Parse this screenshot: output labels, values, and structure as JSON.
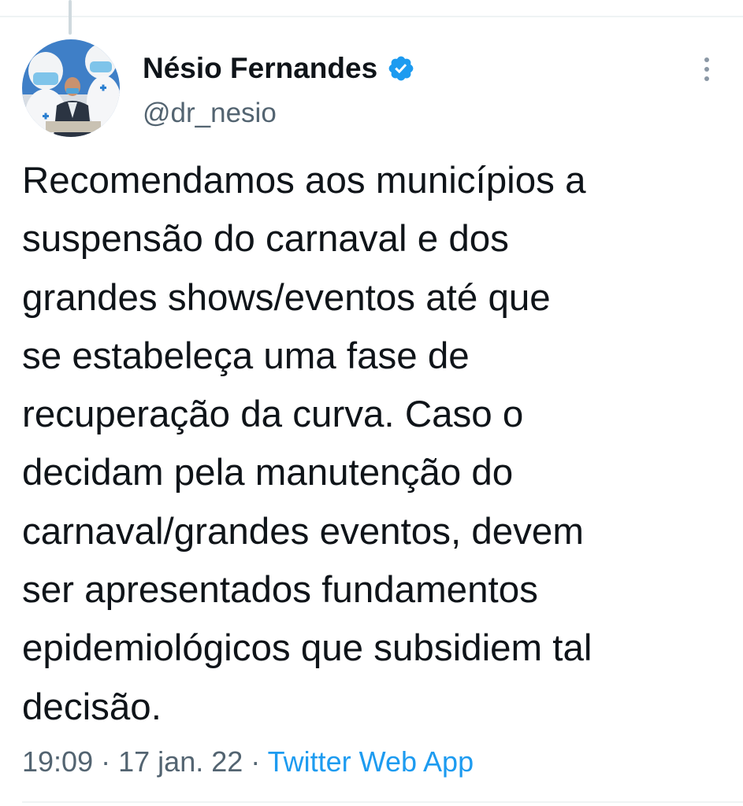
{
  "tweet": {
    "author": {
      "display_name": "Nésio Fernandes",
      "handle": "@dr_nesio",
      "verified": true,
      "verified_color": "#1d9bf0"
    },
    "text": "Recomendamos aos municípios a\nsuspensão do carnaval e dos\ngrandes shows/eventos até que\nse estabeleça uma fase de\nrecuperação da curva. Caso o\ndecidam pela manutenção do\ncarnaval/grandes eventos, devem\nser apresentados fundamentos\nepidemiológicos que subsidiem tal\ndecisão.",
    "time": "19:09",
    "separator": "·",
    "date": "17 jan. 22",
    "source": "Twitter Web App"
  },
  "icons": {
    "verified": "verified-badge-icon",
    "more": "more-options-icon"
  },
  "colors": {
    "text_primary": "#0f1419",
    "text_secondary": "#536471",
    "link": "#1d9bf0"
  }
}
